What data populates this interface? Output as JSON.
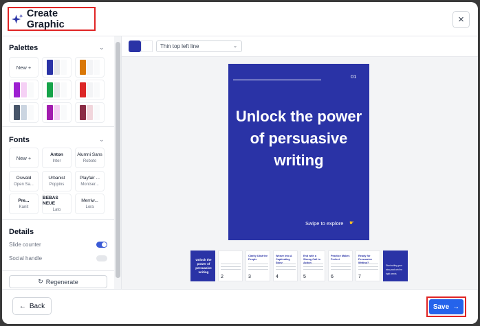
{
  "header": {
    "title": "Create Graphic",
    "close_icon": "×"
  },
  "sidebar": {
    "palettes_title": "Palettes",
    "palettes_new": "New +",
    "palettes": [
      {
        "colors": [
          "#2a33a6",
          "#e5e7eb",
          "#f9fafb"
        ]
      },
      {
        "colors": [
          "#d97706",
          "#f3f4f6",
          "#f9fafb"
        ]
      },
      {
        "colors": [
          "#9d1fd1",
          "#f5d0f5",
          "#f9fafb"
        ]
      },
      {
        "colors": [
          "#16a34a",
          "#e5e7eb",
          "#f9fafb"
        ]
      },
      {
        "colors": [
          "#dc2626",
          "#f3f4f6",
          "#f9fafb"
        ]
      },
      {
        "colors": [
          "#475569",
          "#cbd5e1",
          "#f9fafb"
        ]
      },
      {
        "colors": [
          "#a21caf",
          "#f5d0f5",
          "#f9fafb"
        ]
      },
      {
        "colors": [
          "#8b2c45",
          "#f1d6dc",
          "#f9fafb"
        ]
      }
    ],
    "fonts_title": "Fonts",
    "fonts_new": "New +",
    "fonts": [
      {
        "heading": "Anton",
        "body": "Inter"
      },
      {
        "heading": "Alumni Sans",
        "body": "Roboto"
      },
      {
        "heading": "Oswald",
        "body": "Open Sa..."
      },
      {
        "heading": "Urbanist",
        "body": "Poppins"
      },
      {
        "heading": "Playfair ...",
        "body": "Montser..."
      },
      {
        "heading": "Pre...",
        "body": "Kanit"
      },
      {
        "heading": "BEBAS NEUE",
        "body": "Lato"
      },
      {
        "heading": "Merriw...",
        "body": "Lora"
      }
    ],
    "details_title": "Details",
    "slide_counter_label": "Slide counter",
    "slide_counter_on": true,
    "social_handle_label": "Social handle",
    "social_handle_on": false,
    "regenerate_label": "Regenerate"
  },
  "toolbar": {
    "accent_color": "#2a33a6",
    "style_value": "Thin top left line"
  },
  "slide": {
    "number": "01",
    "headline": "Unlock the power of persuasive writing",
    "swipe": "Swipe to explore"
  },
  "thumbnails": [
    {
      "title": "Unlock the power of persuasive writing",
      "num": "",
      "style": "blue"
    },
    {
      "title": "",
      "num": "2",
      "style": "white"
    },
    {
      "title": "Clarity Ubstrive People",
      "num": "3",
      "style": "white"
    },
    {
      "title": "Weave Into A Captivating Story",
      "num": "4",
      "style": "white"
    },
    {
      "title": "End with a Strong Call to Action",
      "num": "5",
      "style": "white"
    },
    {
      "title": "Practice Makes Perfect",
      "num": "6",
      "style": "white"
    },
    {
      "title": "Ready for Persuasive Writing?",
      "num": "7",
      "style": "white"
    },
    {
      "title": "Start writing your story and win the right words",
      "num": "",
      "style": "blue-small"
    }
  ],
  "footer": {
    "back_label": "Back",
    "save_label": "Save"
  }
}
